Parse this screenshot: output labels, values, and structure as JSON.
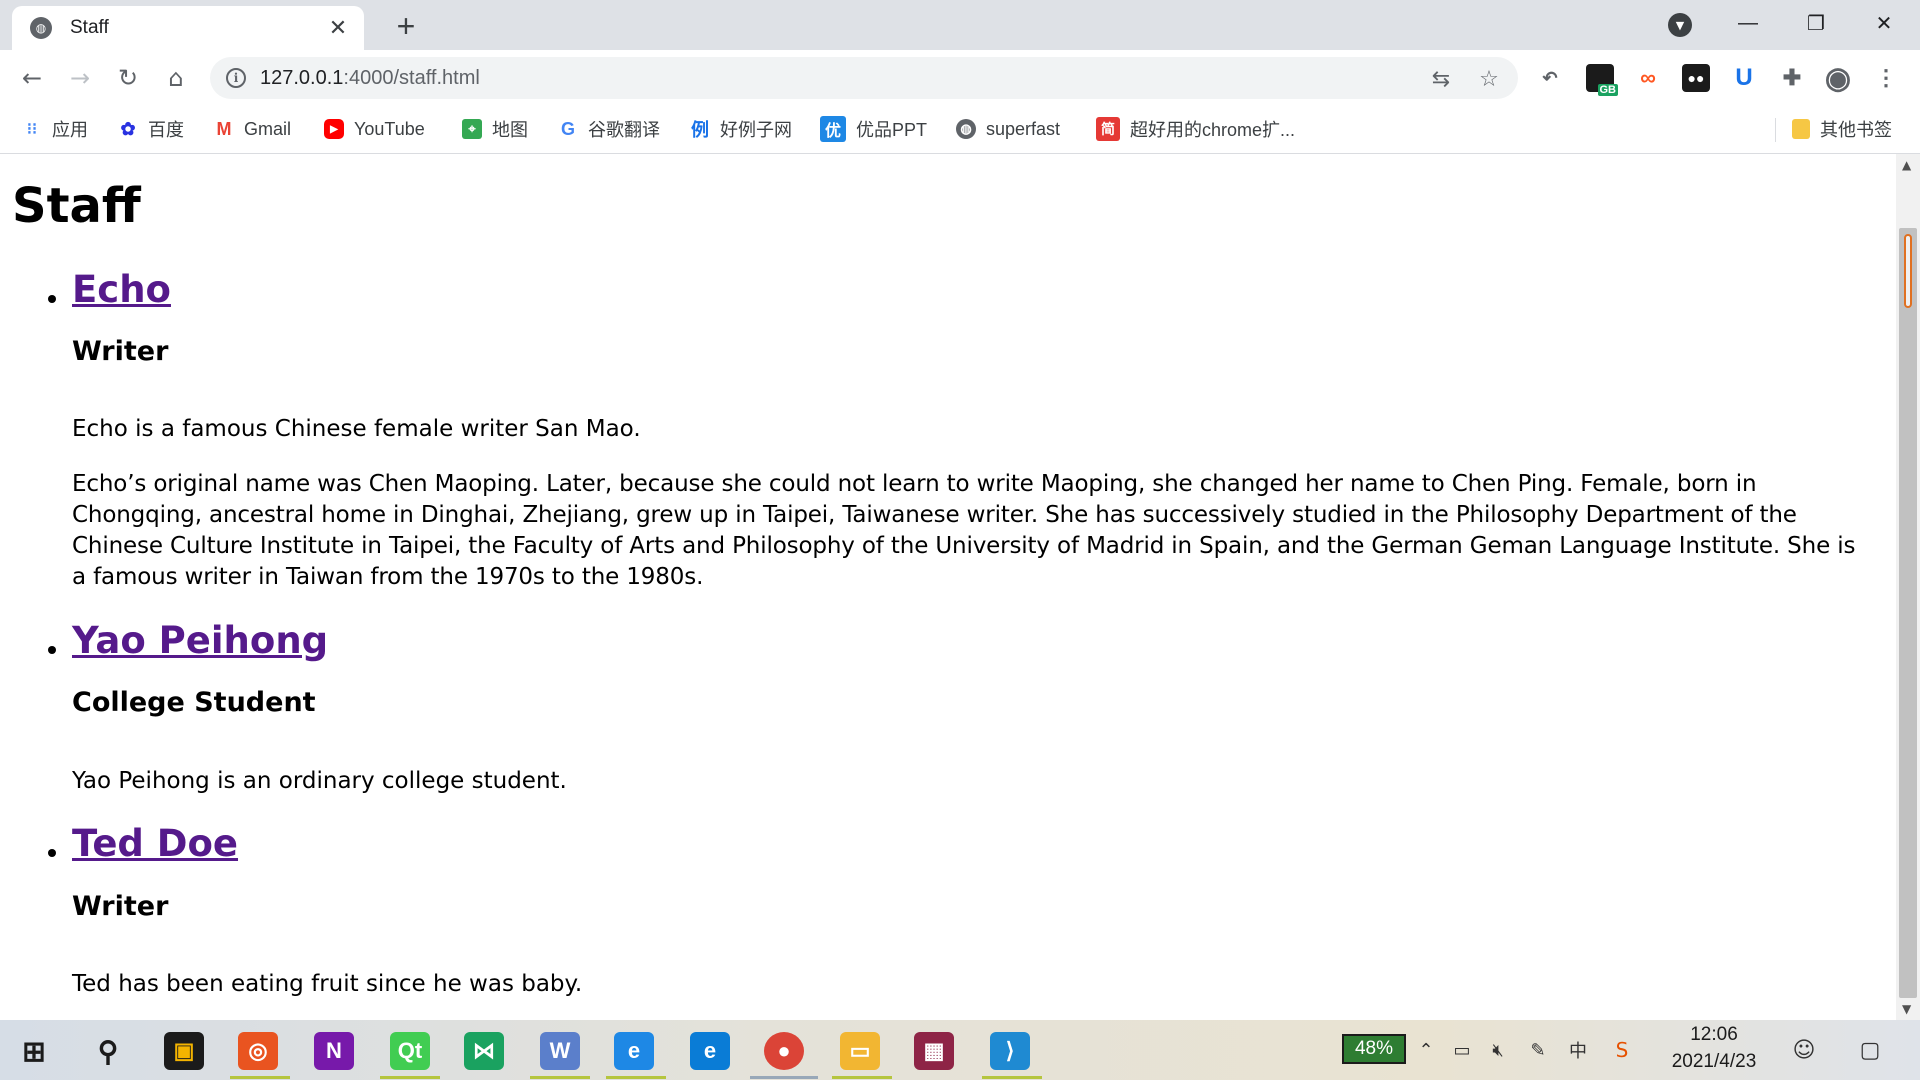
{
  "browser": {
    "tab": {
      "title": "Staff",
      "favicon": "globe-icon"
    },
    "url_host": "127.0.0.1",
    "url_path": ":4000/staff.html"
  },
  "bookmarks": [
    {
      "label": "应用",
      "icon": "apps-grid-icon",
      "color": "#4285f4"
    },
    {
      "label": "百度",
      "icon": "baidu-paw-icon",
      "color": "#2932e1"
    },
    {
      "label": "Gmail",
      "icon": "gmail-icon",
      "color": "#ea4335"
    },
    {
      "label": "YouTube",
      "icon": "youtube-icon",
      "color": "#ff0000"
    },
    {
      "label": "地图",
      "icon": "maps-icon",
      "color": "#34a853"
    },
    {
      "label": "谷歌翻译",
      "icon": "google-g-icon",
      "color": "#4285f4"
    },
    {
      "label": "好例子网",
      "icon": "example-icon",
      "color": "#1a73e8"
    },
    {
      "label": "优品PPT",
      "icon": "ppt-icon",
      "color": "#1e88e5"
    },
    {
      "label": "superfast",
      "icon": "globe-icon",
      "color": "#5f6368"
    },
    {
      "label": "超好用的chrome扩...",
      "icon": "extension-site-icon",
      "color": "#e53935"
    },
    {
      "label": "其他书签",
      "icon": "folder-icon",
      "color": "#f6c744"
    }
  ],
  "page": {
    "title": "Staff",
    "staff": [
      {
        "name": "Echo",
        "role": "Writer",
        "paragraphs": [
          "Echo is a famous Chinese female writer San Mao.",
          "Echo’s original name was Chen Maoping. Later, because she could not learn to write Maoping, she changed her name to Chen Ping. Female, born in Chongqing, ancestral home in Dinghai, Zhejiang, grew up in Taipei, Taiwanese writer. She has successively studied in the Philosophy Department of the Chinese Culture Institute in Taipei, the Faculty of Arts and Philosophy of the University of Madrid in Spain, and the German Geman Language Institute. She is a famous writer in Taiwan from the 1970s to the 1980s."
        ]
      },
      {
        "name": "Yao Peihong",
        "role": "College Student",
        "paragraphs": [
          "Yao Peihong is an ordinary college student."
        ]
      },
      {
        "name": "Ted Doe",
        "role": "Writer",
        "paragraphs": [
          "Ted has been eating fruit since he was baby."
        ]
      }
    ]
  },
  "extensions": {
    "gb_badge": "GB",
    "u_label": "U"
  },
  "taskbar": {
    "battery": "48%",
    "time": "12:06",
    "date": "2021/4/23",
    "tray_ime": "中",
    "apps": [
      {
        "name": "ubuntu-icon",
        "color": "#e95420",
        "glyph": "◎"
      },
      {
        "name": "onenote-icon",
        "color": "#7719aa",
        "glyph": "N"
      },
      {
        "name": "qt-creator-icon",
        "color": "#41cd52",
        "glyph": "Qt"
      },
      {
        "name": "mindmap-icon",
        "color": "#1aa260",
        "glyph": "⋈"
      },
      {
        "name": "vmware-icon",
        "color": "#5b7fcb",
        "glyph": "W"
      },
      {
        "name": "ie-icon",
        "color": "#1e88e5",
        "glyph": "e"
      },
      {
        "name": "edge-icon",
        "color": "#0a7cd6",
        "glyph": "e"
      },
      {
        "name": "chrome-icon",
        "color": "#db4437",
        "glyph": "●"
      },
      {
        "name": "file-explorer-icon",
        "color": "#f2b632",
        "glyph": "▭"
      },
      {
        "name": "winrar-icon",
        "color": "#8e2446",
        "glyph": "▦"
      },
      {
        "name": "vscode-icon",
        "color": "#1f8ad2",
        "glyph": "⟩"
      }
    ]
  }
}
